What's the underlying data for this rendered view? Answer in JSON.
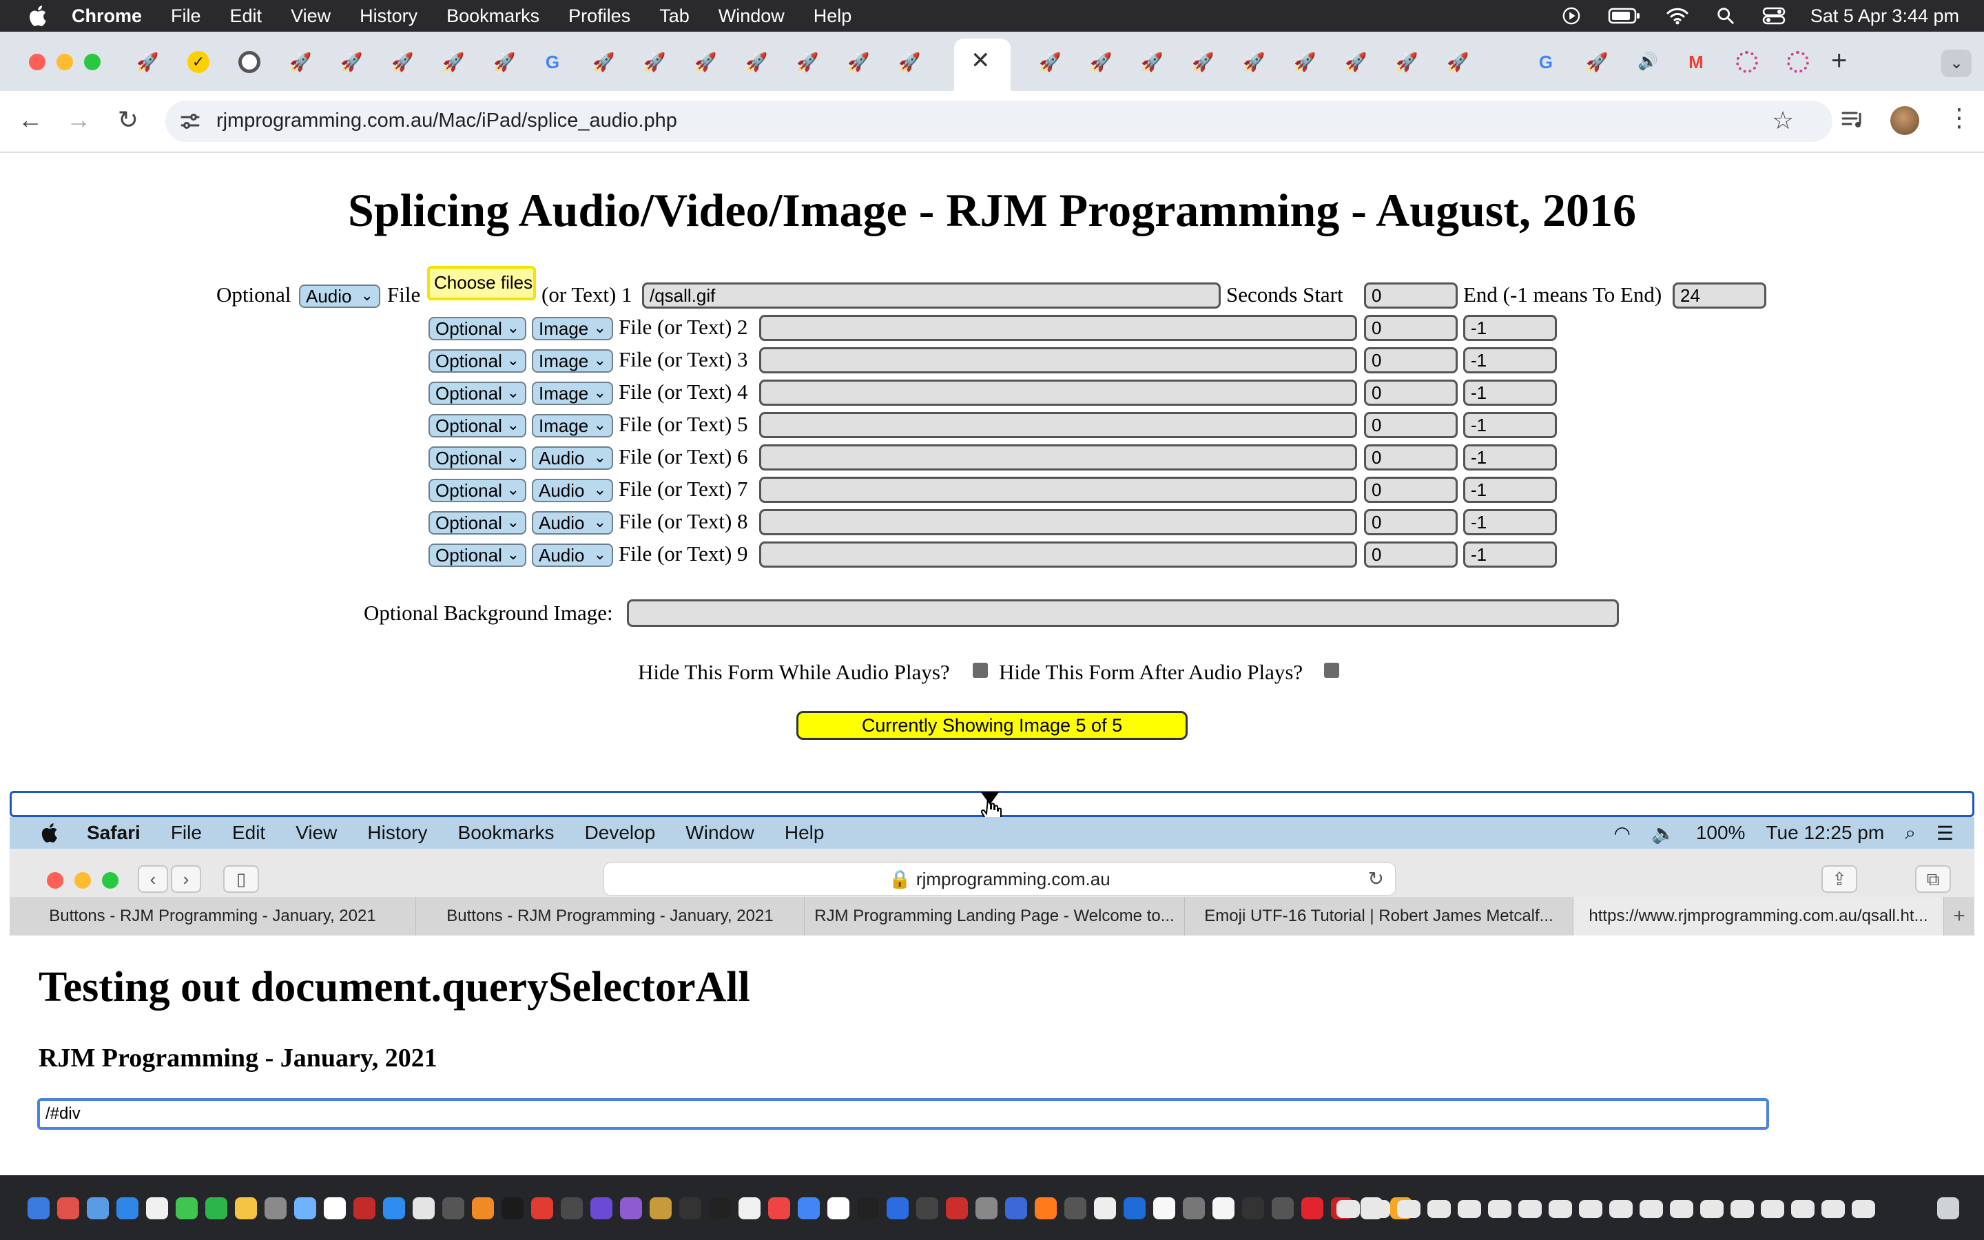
{
  "menubar": {
    "app": "Chrome",
    "items": [
      "File",
      "Edit",
      "View",
      "History",
      "Bookmarks",
      "Profiles",
      "Tab",
      "Window",
      "Help"
    ],
    "clock": "Sat 5 Apr  3:44 pm"
  },
  "browser": {
    "url": "rjmprogramming.com.au/Mac/iPad/splice_audio.php"
  },
  "page": {
    "title": "Splicing Audio/Video/Image - RJM Programming - August, 2016",
    "row1": {
      "optional_label": "Optional",
      "type": "Audio",
      "file_label": "File",
      "choose_label": "Choose files",
      "or_text": "(or Text) 1",
      "value": "/qsall.gif",
      "seconds_start_label": "Seconds Start",
      "start": "0",
      "end_label": "End (-1 means To End)",
      "end": "24"
    },
    "rows": [
      {
        "optional": "Optional",
        "type": "Image",
        "label": "File (or Text) 2",
        "value": "",
        "start": "0",
        "end": "-1"
      },
      {
        "optional": "Optional",
        "type": "Image",
        "label": "File (or Text) 3",
        "value": "",
        "start": "0",
        "end": "-1"
      },
      {
        "optional": "Optional",
        "type": "Image",
        "label": "File (or Text) 4",
        "value": "",
        "start": "0",
        "end": "-1"
      },
      {
        "optional": "Optional",
        "type": "Image",
        "label": "File (or Text) 5",
        "value": "",
        "start": "0",
        "end": "-1"
      },
      {
        "optional": "Optional",
        "type": "Audio",
        "label": "File (or Text) 6",
        "value": "",
        "start": "0",
        "end": "-1"
      },
      {
        "optional": "Optional",
        "type": "Audio",
        "label": "File (or Text) 7",
        "value": "",
        "start": "0",
        "end": "-1"
      },
      {
        "optional": "Optional",
        "type": "Audio",
        "label": "File (or Text) 8",
        "value": "",
        "start": "0",
        "end": "-1"
      },
      {
        "optional": "Optional",
        "type": "Audio",
        "label": "File (or Text) 9",
        "value": "",
        "start": "0",
        "end": "-1"
      }
    ],
    "background_label": "Optional Background Image:",
    "background_value": "",
    "hide_while_label": "Hide This Form While Audio Plays?",
    "hide_after_label": "Hide This Form After Audio Plays?",
    "status_button": "Currently Showing Image 5 of 5"
  },
  "embedded": {
    "menubar": {
      "app": "Safari",
      "items": [
        "File",
        "Edit",
        "View",
        "History",
        "Bookmarks",
        "Develop",
        "Window",
        "Help"
      ],
      "battery": "100%",
      "clock": "Tue 12:25 pm"
    },
    "url": "rjmprogramming.com.au",
    "tabs": [
      "Buttons - RJM Programming - January, 2021",
      "Buttons - RJM Programming - January, 2021",
      "RJM Programming Landing Page - Welcome to...",
      "Emoji UTF-16 Tutorial | Robert James Metcalf...",
      "https://www.rjmprogramming.com.au/qsall.ht..."
    ],
    "heading": "Testing out document.querySelectorAll",
    "subheading": "RJM Programming - January, 2021",
    "input_value": "/#div"
  },
  "colors": {
    "select_bg": "#b9d9ef",
    "button_bg": "#ffff00",
    "divider": "#1a56c9"
  }
}
